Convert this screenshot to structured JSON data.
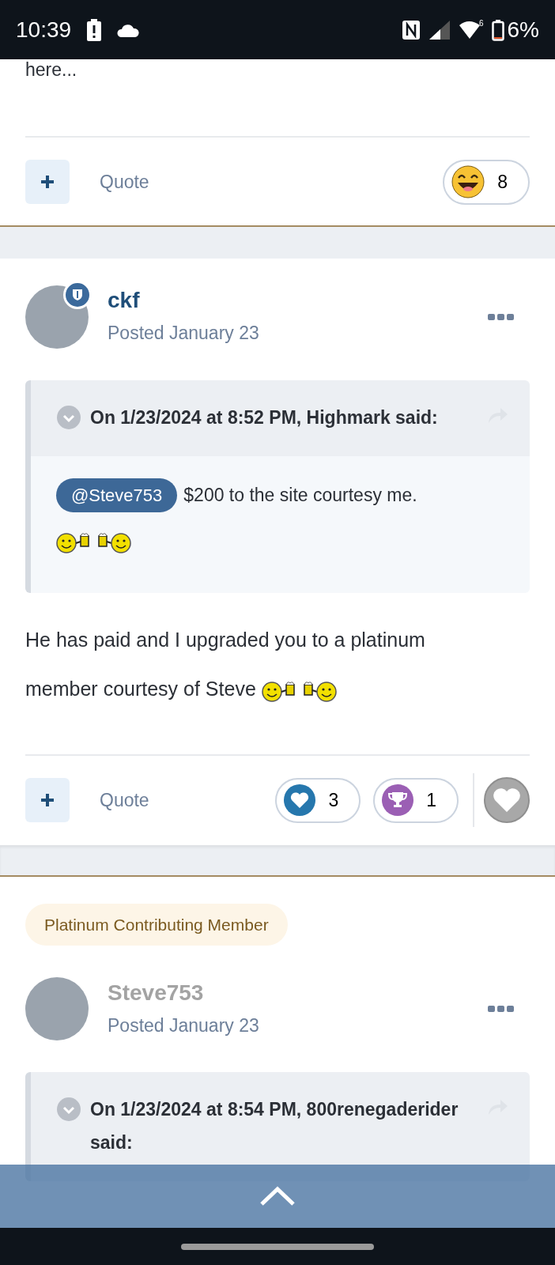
{
  "status_bar": {
    "time": "10:39",
    "wifi_standard": "6",
    "battery": "6%"
  },
  "previous_post": {
    "text_tail": "here...",
    "quote_label": "Quote",
    "reactions": [
      {
        "kind": "laugh",
        "count": "8"
      }
    ]
  },
  "posts": [
    {
      "author": {
        "name": "ckf",
        "color": "#1f4e79",
        "staff_badge": true
      },
      "posted": "Posted January 23",
      "quote": {
        "header": "On 1/23/2024 at 8:52 PM, Highmark said:",
        "mention": "@Steve753",
        "text": "$200 to the site courtesy me.",
        "emoticon": true
      },
      "body": {
        "text": "He has paid and I upgraded you to a platinum member courtesy of Steve",
        "emoticon": true
      },
      "quote_label": "Quote",
      "reactions": [
        {
          "kind": "heart",
          "count": "3"
        },
        {
          "kind": "trophy",
          "count": "1"
        }
      ],
      "liked": false
    },
    {
      "group_badge": "Platinum Contributing Member",
      "author": {
        "name": "Steve753",
        "color": "#a3a3a3",
        "staff_badge": false
      },
      "posted": "Posted January 23",
      "quote": {
        "header": "On 1/23/2024 at 8:54 PM, 800renegaderider said:"
      }
    }
  ]
}
